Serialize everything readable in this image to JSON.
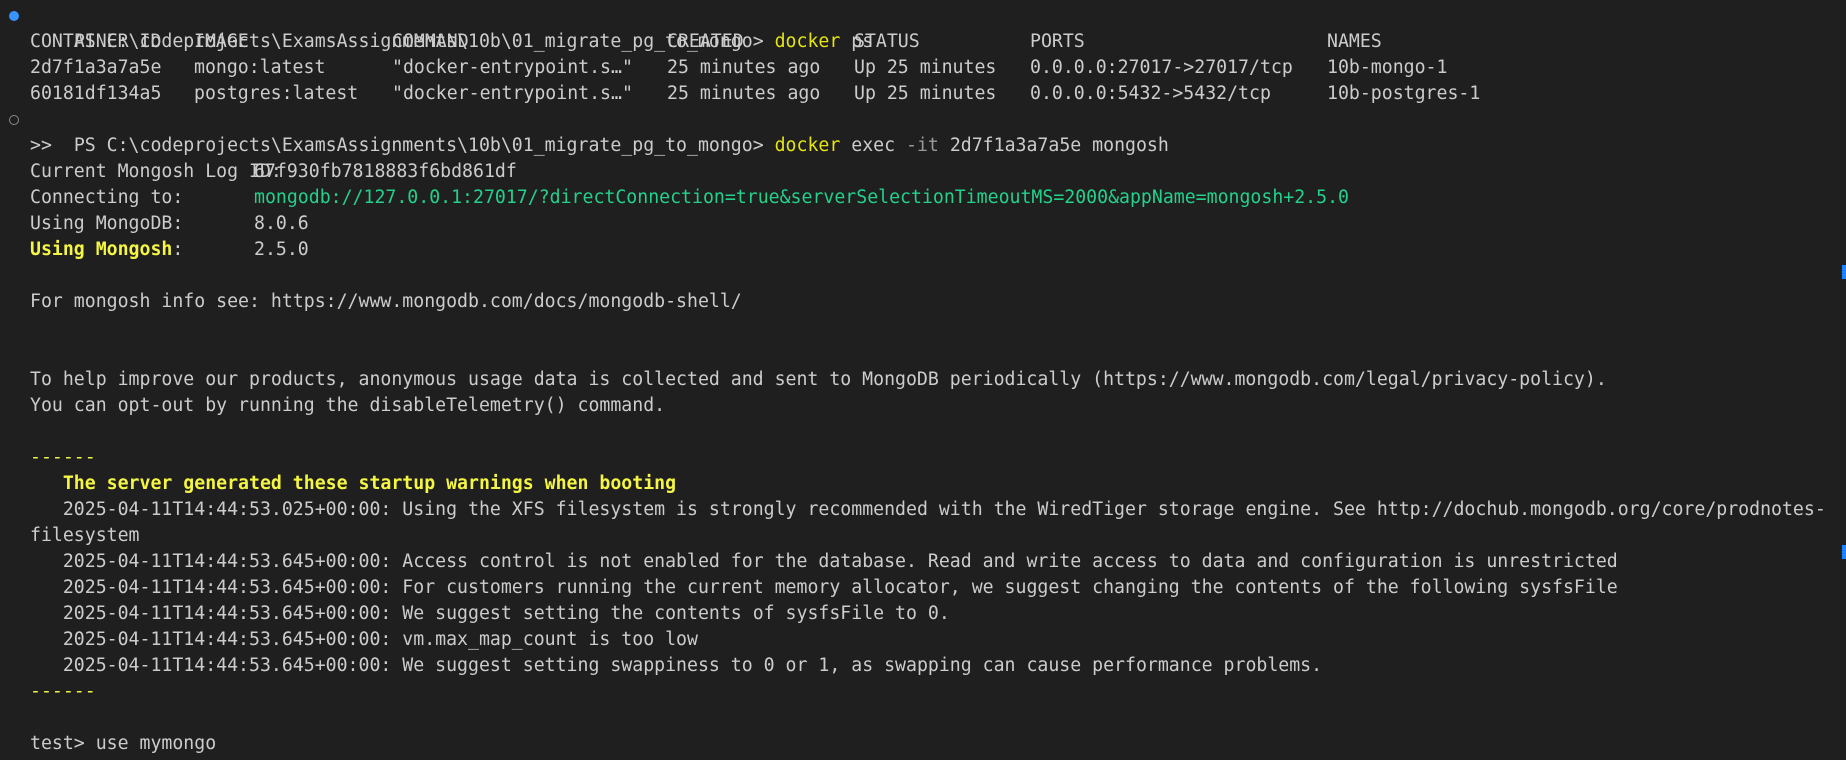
{
  "colors": {
    "background": "#1f1f1f",
    "text": "#cccccc",
    "command": "#e5e510",
    "green": "#23d18b",
    "yellow": "#f5f543",
    "decoration_success": "#3794ff"
  },
  "icons": {
    "decoration_1": "command-decoration-icon",
    "decoration_2": "command-decoration-icon"
  },
  "prompt1": {
    "prompt": "PS C:\\codeprojects\\ExamsAssignments\\10b\\01_migrate_pg_to_mongo> ",
    "cmd": "docker",
    "args": " ps"
  },
  "ps_table": {
    "headers": [
      "CONTAINER ID",
      "IMAGE",
      "COMMAND",
      "CREATED",
      "STATUS",
      "PORTS",
      "NAMES"
    ],
    "rows": [
      [
        "2d7f1a3a7a5e",
        "mongo:latest",
        "\"docker-entrypoint.s…\"",
        "25 minutes ago",
        "Up 25 minutes",
        "0.0.0.0:27017->27017/tcp",
        "10b-mongo-1"
      ],
      [
        "60181df134a5",
        "postgres:latest",
        "\"docker-entrypoint.s…\"",
        "25 minutes ago",
        "Up 25 minutes",
        "0.0.0.0:5432->5432/tcp",
        "10b-postgres-1"
      ]
    ]
  },
  "prompt2": {
    "prompt": "PS C:\\codeprojects\\ExamsAssignments\\10b\\01_migrate_pg_to_mongo> ",
    "cmd": "docker",
    "args1": " exec ",
    "flag": "-it",
    "args2": " 2d7f1a3a7a5e mongosh"
  },
  "continuation": ">>",
  "info": {
    "log_id_label": "Current Mongosh Log ID:",
    "log_id_value": "67f930fb7818883f6bd861df",
    "connecting_label": "Connecting to:",
    "connecting_value": "mongodb://127.0.0.1:27017/?directConnection=true&serverSelectionTimeoutMS=2000&appName=mongosh+2.5.0",
    "using_mongodb_label": "Using MongoDB:",
    "using_mongodb_value": "8.0.6",
    "using_mongosh_label": "Using Mongosh",
    "using_mongosh_colon": ":",
    "using_mongosh_value": "2.5.0"
  },
  "info_see": "For mongosh info see: https://www.mongodb.com/docs/mongodb-shell/",
  "telemetry": [
    "To help improve our products, anonymous usage data is collected and sent to MongoDB periodically (https://www.mongodb.com/legal/privacy-policy).",
    "You can opt-out by running the disableTelemetry() command."
  ],
  "separator": "------",
  "warnings_title": "The server generated these startup warnings when booting",
  "warnings": [
    "2025-04-11T14:44:53.025+00:00: Using the XFS filesystem is strongly recommended with the WiredTiger storage engine. See http://dochub.mongodb.org/core/prodnotes-",
    "filesystem",
    "2025-04-11T14:44:53.645+00:00: Access control is not enabled for the database. Read and write access to data and configuration is unrestricted",
    "2025-04-11T14:44:53.645+00:00: For customers running the current memory allocator, we suggest changing the contents of the following sysfsFile",
    "2025-04-11T14:44:53.645+00:00: We suggest setting the contents of sysfsFile to 0.",
    "2025-04-11T14:44:53.645+00:00: vm.max_map_count is too low",
    "2025-04-11T14:44:53.645+00:00: We suggest setting swappiness to 0 or 1, as swapping can cause performance problems."
  ],
  "mongo_prompt": "test> ",
  "mongo_input": "use mymongo"
}
